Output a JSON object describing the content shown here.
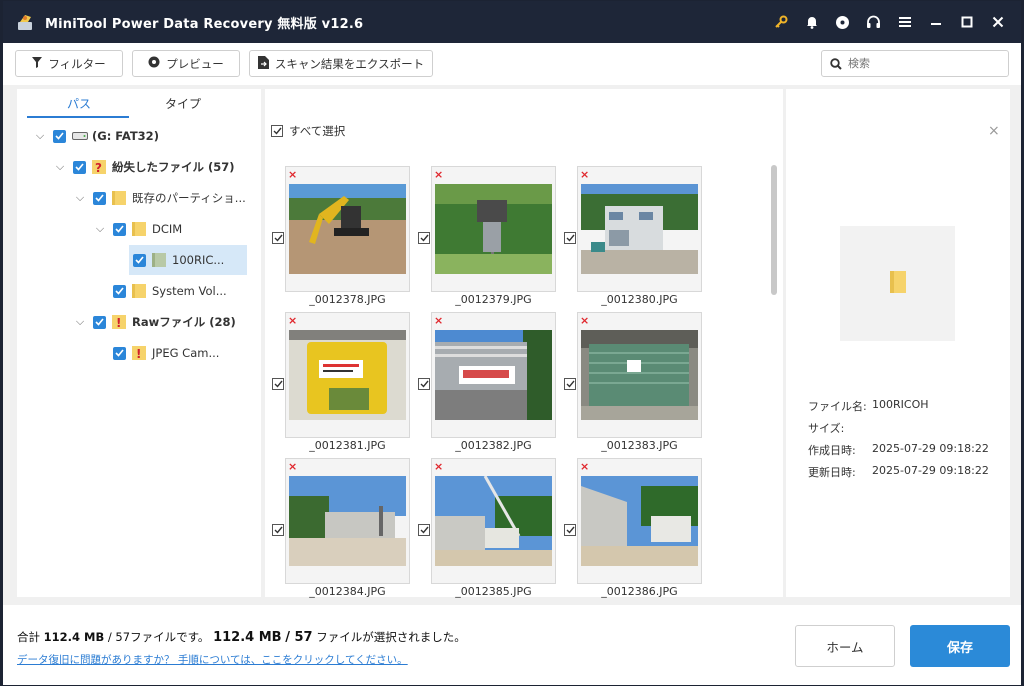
{
  "window": {
    "title": "MiniTool Power Data Recovery 無料版 v12.6"
  },
  "title_icons": [
    "key-icon",
    "bell-icon",
    "disc-icon",
    "headset-icon",
    "menu-icon",
    "minimize-icon",
    "maximize-icon",
    "close-icon"
  ],
  "toolbar": {
    "filter_label": "フィルター",
    "preview_label": "プレビュー",
    "export_label": "スキャン結果をエクスポート",
    "search_placeholder": "検索"
  },
  "tabs": {
    "path": "パス",
    "type": "タイプ"
  },
  "tree": {
    "drive": "(G: FAT32)",
    "lost_files": "紛失したファイル (57)",
    "existing_partition": "既存のパーティショ...",
    "dcim": "DCIM",
    "folder_100ricoh": "100RIC...",
    "system_volume": "System Vol...",
    "raw_files": "Rawファイル (28)",
    "jpeg_camera": "JPEG Cam..."
  },
  "center": {
    "select_all_label": "すべて選択",
    "files": [
      {
        "name": "_0012378.JPG"
      },
      {
        "name": "_0012379.JPG"
      },
      {
        "name": "_0012380.JPG"
      },
      {
        "name": "_0012381.JPG"
      },
      {
        "name": "_0012382.JPG"
      },
      {
        "name": "_0012383.JPG"
      },
      {
        "name": "_0012384.JPG"
      },
      {
        "name": "_0012385.JPG"
      },
      {
        "name": "_0012386.JPG"
      }
    ]
  },
  "details": {
    "name_label": "ファイル名:",
    "name_value": "100RICOH",
    "size_label": "サイズ:",
    "size_value": "",
    "created_label": "作成日時:",
    "created_value": "2025-07-29 09:18:22",
    "modified_label": "更新日時:",
    "modified_value": "2025-07-29 09:18:22"
  },
  "footer": {
    "total_prefix": "合計",
    "total_size": "112.4 MB",
    "total_count": "/ 57ファイルです。",
    "selected_size": "112.4 MB",
    "selected_count": "/ 57",
    "selected_suffix": "ファイルが選択されました。",
    "help_link": "データ復旧に問題がありますか？ 手順については、ここをクリックしてください。",
    "home_label": "ホーム",
    "save_label": "保存"
  },
  "colors": {
    "accent": "#2b8ad8",
    "titlebar": "#1e2638",
    "key_icon": "#f0b429",
    "delete_mark": "#e0262c"
  }
}
